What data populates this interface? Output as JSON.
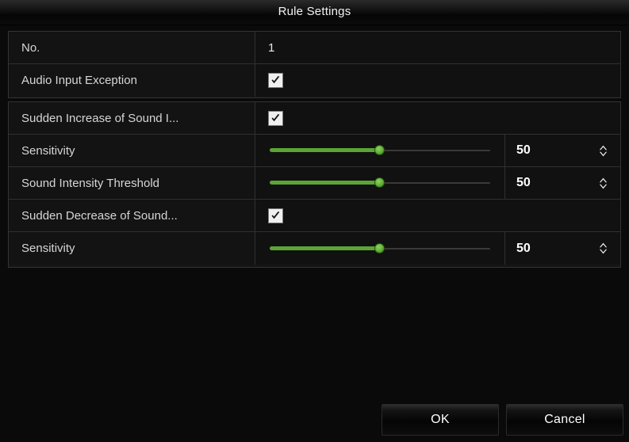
{
  "dialog": {
    "title": "Rule Settings"
  },
  "table": {
    "groups": [
      {
        "rows": [
          {
            "label": "No.",
            "type": "text",
            "value": "1"
          },
          {
            "label": "Audio Input Exception",
            "type": "checkbox",
            "checked": true
          }
        ]
      },
      {
        "rows": [
          {
            "label": "Sudden Increase of Sound I...",
            "type": "checkbox",
            "checked": true
          },
          {
            "label": "Sensitivity",
            "type": "slider",
            "value": "50",
            "percent": 50
          },
          {
            "label": "Sound Intensity Threshold",
            "type": "slider",
            "value": "50",
            "percent": 50
          },
          {
            "label": "Sudden Decrease of Sound...",
            "type": "checkbox",
            "checked": true
          },
          {
            "label": "Sensitivity",
            "type": "slider",
            "value": "50",
            "percent": 50
          }
        ]
      }
    ]
  },
  "footer": {
    "ok_label": "OK",
    "cancel_label": "Cancel"
  },
  "icons": {
    "check": "check-icon",
    "spinner_up": "chevron-up-icon",
    "spinner_down": "chevron-down-icon"
  },
  "colors": {
    "accent_green": "#5aa535",
    "knob_green": "#6fbf42",
    "dialog_bg": "#0a0a0a",
    "row_bg": "#131313",
    "border": "#303030",
    "text": "#d6d6d6",
    "value_text": "#ffffff"
  }
}
